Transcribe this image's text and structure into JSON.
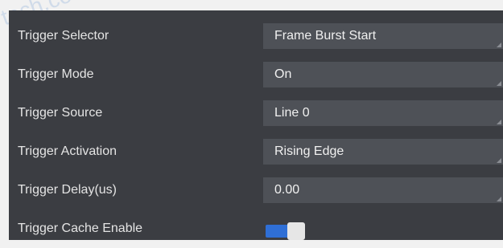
{
  "rows": [
    {
      "label": "Trigger Selector",
      "value": "Frame Burst Start"
    },
    {
      "label": "Trigger Mode",
      "value": "On"
    },
    {
      "label": "Trigger Source",
      "value": "Line 0"
    },
    {
      "label": "Trigger Activation",
      "value": "Rising Edge"
    },
    {
      "label": "Trigger Delay(us)",
      "value": "0.00"
    },
    {
      "label": "Trigger Cache Enable",
      "value": true
    }
  ],
  "colors": {
    "panel": "#3b3d42",
    "field": "#4e5157",
    "toggle_on": "#2f6fd6"
  }
}
